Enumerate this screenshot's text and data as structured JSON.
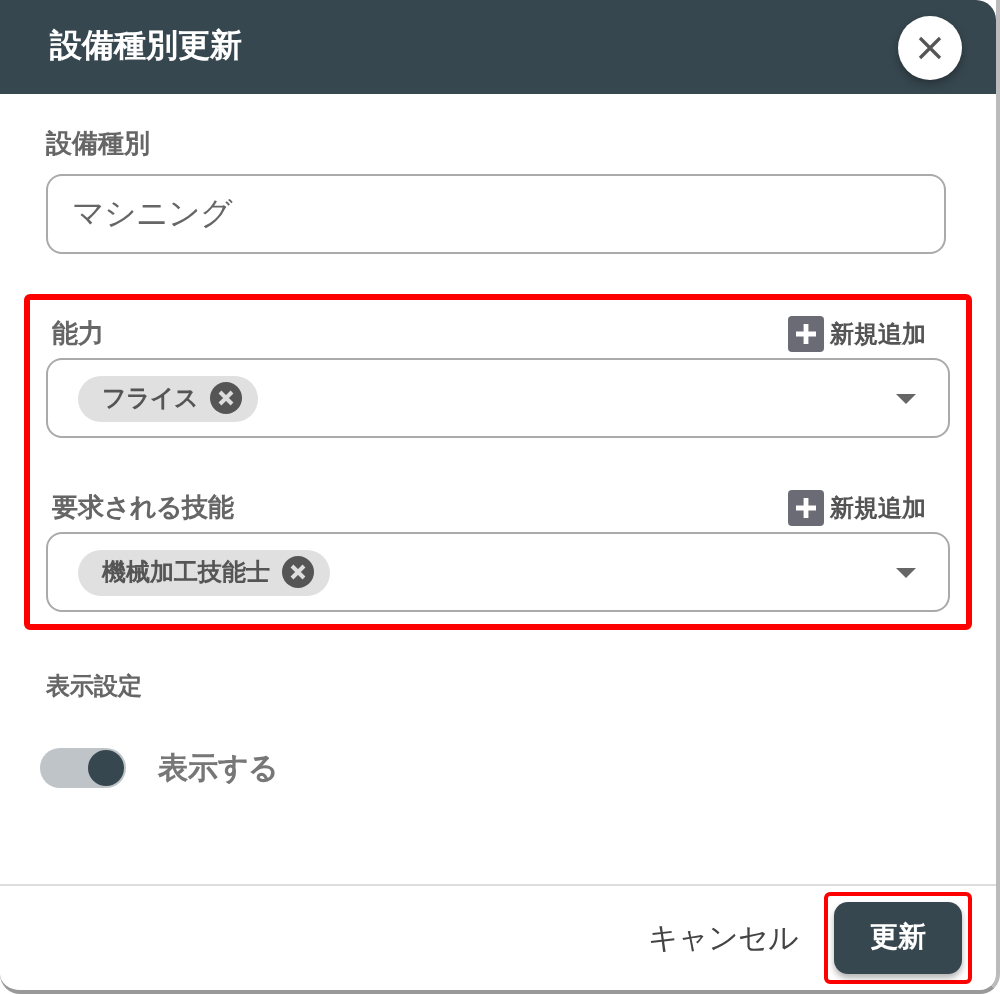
{
  "dialog": {
    "title": "設備種別更新"
  },
  "name_field": {
    "label": "設備種別",
    "value": "マシニング"
  },
  "selects_group": {
    "highlighted": true,
    "selects": [
      {
        "label": "能力",
        "add_label": "新規追加",
        "chips": [
          "フライス"
        ]
      },
      {
        "label": "要求される技能",
        "add_label": "新規追加",
        "chips": [
          "機械加工技能士"
        ]
      }
    ]
  },
  "display": {
    "label": "表示設定",
    "toggle_label": "表示する",
    "on": true
  },
  "buttons": [
    {
      "kind": "text",
      "label": "キャンセル",
      "highlighted": false
    },
    {
      "kind": "primary",
      "label": "更新",
      "highlighted": true
    }
  ]
}
